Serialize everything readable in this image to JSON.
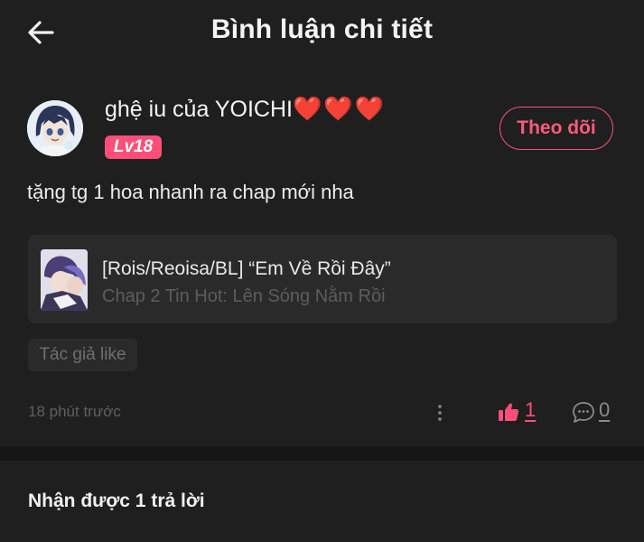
{
  "header": {
    "back_icon": "arrow-left-icon",
    "title": "Bình luận chi tiết"
  },
  "comment": {
    "username": "ghệ iu của YOICHI",
    "username_hearts": "❤️❤️❤️",
    "level": "Lv18",
    "follow_label": "Theo dõi",
    "text": "tặng tg 1 hoa nhanh ra chap mới nha",
    "story": {
      "title": "[Rois/Reoisa/BL] “Em Về Rồi Đây”",
      "subtitle": "Chap 2 Tin Hot: Lên Sóng Nằm Rồi"
    },
    "author_like_tag": "Tác giả like",
    "timestamp": "18 phút trước",
    "like_count": "1",
    "reply_count": "0"
  },
  "replies": {
    "heading": "Nhận được 1 trả lời"
  },
  "colors": {
    "background": "#1f1f1f",
    "card": "#2a2a2a",
    "accent": "#ff4f79",
    "divider": "#161616"
  }
}
